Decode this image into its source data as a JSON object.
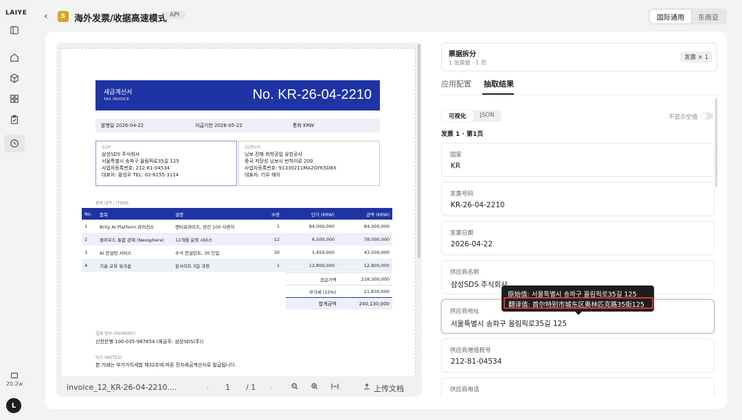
{
  "rail": {
    "logo": "LAIYE",
    "icons": [
      "panel-icon",
      "home-icon",
      "cube-icon",
      "grid-icon",
      "clipboard-icon",
      "clock-icon"
    ],
    "credit": "20.2w",
    "avatar": "L"
  },
  "header": {
    "app_icon": "S",
    "title": "海外发票/收据高速模式",
    "api_badge": "API",
    "regions": [
      "国际通用",
      "东南亚"
    ],
    "active_region": "国际通用"
  },
  "invoice": {
    "title_kr": "세금계산서",
    "title_en": "TAX INVOICE",
    "number": "No.  KR-26-04-2210",
    "issue_date": "발행일  2026-04-22",
    "due_date": "지급기한  2026-05-22",
    "currency": "통화  KRW",
    "supplier": {
      "cap": "공급자",
      "lines": [
        "삼성SDS 주식회사",
        "서울특별시 송파구 올림픽로35길 125",
        "사업자등록번호: 212-81-04534",
        "대표자: 황성우 TEL: 02-6155-3114"
      ]
    },
    "buyer": {
      "cap": "공급받는자",
      "lines": [
        "닝보 전해 화학공업 유한공사",
        "중국 저장성 닝보시 빈하이로 200",
        "사업자등록번호: 91330211MA2GYK5D8X",
        "대표자: 리우 웨이"
      ]
    },
    "items_caption": "품목 내역 / ITEMS",
    "columns": [
      "No.",
      "품목",
      "설명",
      "수량",
      "단가 (KRW)",
      "금액 (KRW)"
    ],
    "rows": [
      [
        "1",
        "Brity AI Platform 라이선스",
        "엔터프라이즈, 연간 100 사용자",
        "1",
        "84,000,000",
        "84,000,000"
      ],
      [
        "2",
        "클라우드 통합 관제 (Nexsphere)",
        "12개월 운영 서비스",
        "12",
        "6,500,000",
        "78,000,000"
      ],
      [
        "3",
        "AI 컨설팅 서비스",
        "수석 컨설턴트, 30 인일",
        "30",
        "1,450,000",
        "43,500,000"
      ],
      [
        "4",
        "기술 교육 워크숍",
        "온사이트 3일 과정",
        "1",
        "12,800,000",
        "12,800,000"
      ]
    ],
    "totals": [
      [
        "공급가액",
        "218,300,000"
      ],
      [
        "부가세 (10%)",
        "21,830,000"
      ],
      [
        "합계금액",
        "240,130,000"
      ]
    ],
    "payment_caption": "결제 정보 (PAYMENT)",
    "payment": "신한은행 100-035-987654 (예금주: 삼성SDS(주))",
    "notes_caption": "비고 (NOTES)",
    "notes": "본 거래는 부가가치세법 제32조에 따른 전자세금계산서로 발급됩니다."
  },
  "viewer_bar": {
    "filename": "invoice_12_KR-26-04-2210....",
    "prev": "‹",
    "page": "1",
    "total": "/ 1",
    "next": "›",
    "upload": "上传文档"
  },
  "split": {
    "title": "票据拆分",
    "subtitle": "1 张票据 · 1 页",
    "badge": "发票 × 1"
  },
  "tabs": [
    "应用配置",
    "抽取结果"
  ],
  "active_tab": "抽取结果",
  "view_modes": [
    "可视化",
    "JSON"
  ],
  "hide_empty_label": "不显示空值",
  "section_title": "发票 1 · 第1页",
  "fields": [
    {
      "label": "国家",
      "value": "KR"
    },
    {
      "label": "发票号码",
      "value": "KR-26-04-2210"
    },
    {
      "label": "发票日期",
      "value": "2026-04-22"
    },
    {
      "label": "供应商名称",
      "value": "삼성SDS 주식회사"
    },
    {
      "label": "供应商地址",
      "value": "서울특별시 송파구 올림픽로35길 125"
    },
    {
      "label": "供应商增值税号",
      "value": "212-81-04534"
    },
    {
      "label": "供应商电话",
      "value": ""
    }
  ],
  "tooltip": {
    "original": "原始值: 서울특별시 송파구 올림픽로35길 125",
    "translated": "翻译值: 首尔特别市城东区奥林匹克路35街125"
  }
}
